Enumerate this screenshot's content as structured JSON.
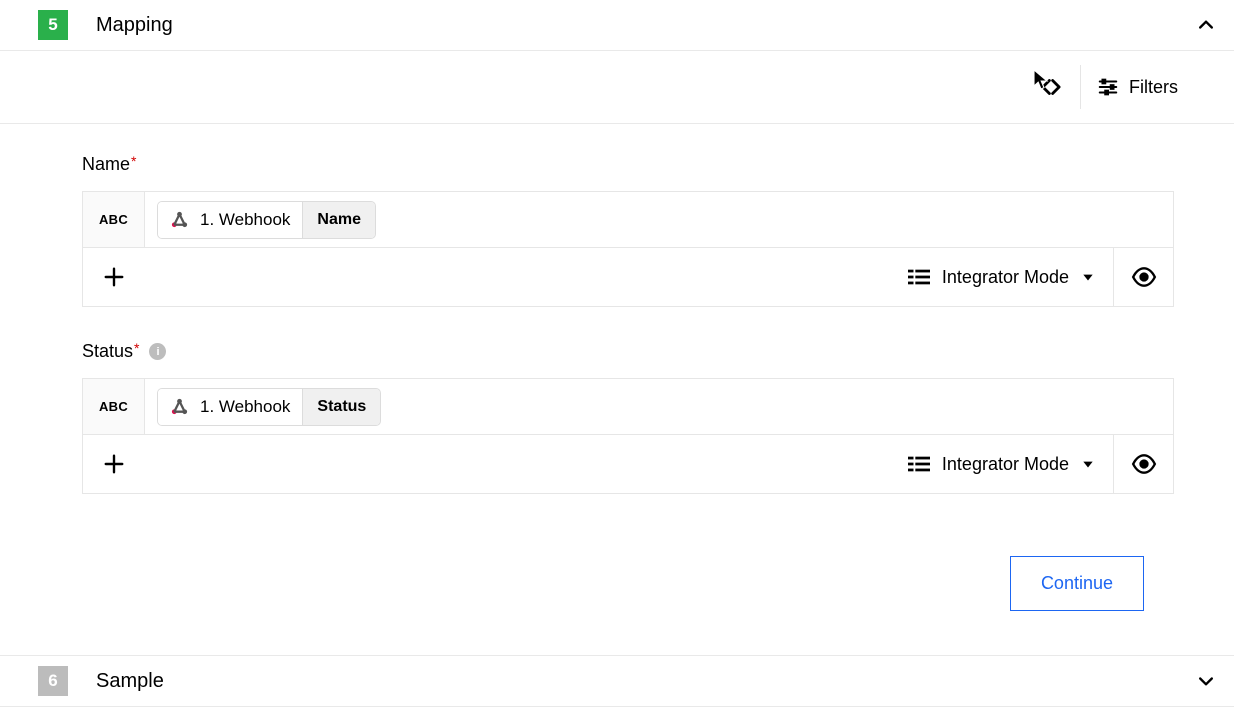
{
  "step5": {
    "number": "5",
    "title": "Mapping"
  },
  "toolbar": {
    "filters_label": "Filters"
  },
  "fields": [
    {
      "label": "Name",
      "required": true,
      "info": false,
      "type_badge": "ABC",
      "token_source": "1. Webhook",
      "token_field": "Name",
      "mode_label": "Integrator Mode"
    },
    {
      "label": "Status",
      "required": true,
      "info": true,
      "type_badge": "ABC",
      "token_source": "1. Webhook",
      "token_field": "Status",
      "mode_label": "Integrator Mode"
    }
  ],
  "actions": {
    "continue": "Continue"
  },
  "step6": {
    "number": "6",
    "title": "Sample"
  }
}
